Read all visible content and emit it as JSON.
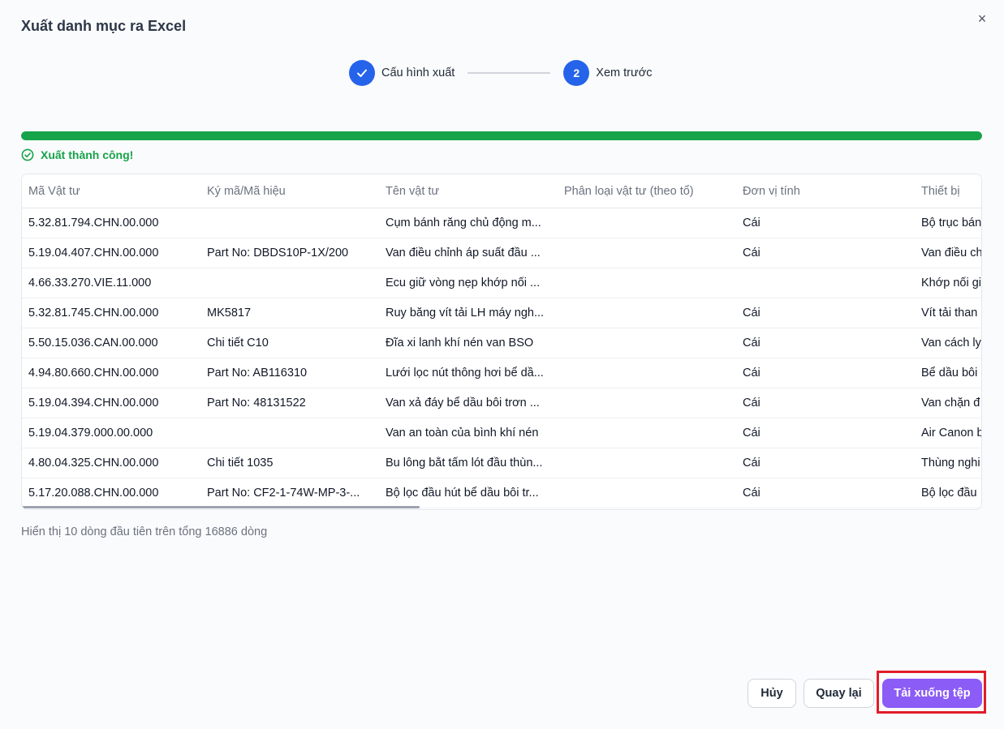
{
  "dialog": {
    "title": "Xuất danh mục ra Excel",
    "close_label": "×"
  },
  "stepper": {
    "steps": [
      {
        "label": "Cấu hình xuất",
        "state": "completed",
        "icon": "check-icon"
      },
      {
        "label": "Xem trước",
        "number": "2",
        "state": "active"
      }
    ]
  },
  "progress": {
    "percent": 100,
    "status_text": "Xuất thành công!",
    "status_icon": "check-circle-icon",
    "color": "#16a34a"
  },
  "table": {
    "columns": [
      "Mã Vật tư",
      "Ký mã/Mã hiệu",
      "Tên vật tư",
      "Phân loại vật tư (theo tổ)",
      "Đơn vị tính",
      "Thiết bị"
    ],
    "rows": [
      [
        "5.32.81.794.CHN.00.000",
        "",
        "Cụm bánh răng chủ động m...",
        "",
        "Cái",
        "Bộ trục bán"
      ],
      [
        "5.19.04.407.CHN.00.000",
        "Part No: DBDS10P-1X/200",
        "Van điều chỉnh áp suất đầu ...",
        "",
        "Cái",
        "Van điều ch"
      ],
      [
        "4.66.33.270.VIE.11.000",
        "",
        "Ecu giữ vòng nẹp khớp nối ...",
        "",
        "",
        "Khớp nối gi"
      ],
      [
        "5.32.81.745.CHN.00.000",
        "MK5817",
        "Ruy băng vít tải LH máy ngh...",
        "",
        "Cái",
        "Vít tải than"
      ],
      [
        "5.50.15.036.CAN.00.000",
        "Chi tiết C10",
        "Đĩa xi lanh khí nén van BSO",
        "",
        "Cái",
        "Van cách ly"
      ],
      [
        "4.94.80.660.CHN.00.000",
        "Part No: AB116310",
        "Lưới lọc nút thông hơi bể dầ...",
        "",
        "Cái",
        "Bể dầu bôi"
      ],
      [
        "5.19.04.394.CHN.00.000",
        "Part No: 48131522",
        "Van xả đáy bể dầu bôi trơn ...",
        "",
        "Cái",
        "Van chặn đ"
      ],
      [
        "5.19.04.379.000.00.000",
        "",
        "Van an toàn của bình khí nén",
        "",
        "Cái",
        "Air Canon b"
      ],
      [
        "4.80.04.325.CHN.00.000",
        "Chi tiết 1035",
        "Bu lông bắt tấm lót đầu thùn...",
        "",
        "Cái",
        "Thùng nghi"
      ],
      [
        "5.17.20.088.CHN.00.000",
        "Part No: CF2-1-74W-MP-3-...",
        "Bộ lọc đầu hút bể dầu bôi tr...",
        "",
        "Cái",
        "Bộ lọc đầu"
      ]
    ]
  },
  "footer": {
    "note": "Hiển thị 10 dòng đầu tiên trên tổng 16886 dòng",
    "cancel_label": "Hủy",
    "back_label": "Quay lại",
    "download_label": "Tải xuống tệp"
  },
  "colors": {
    "primary_step": "#2563eb",
    "download_button": "#8b5cf6",
    "highlight": "#e11d2a"
  }
}
